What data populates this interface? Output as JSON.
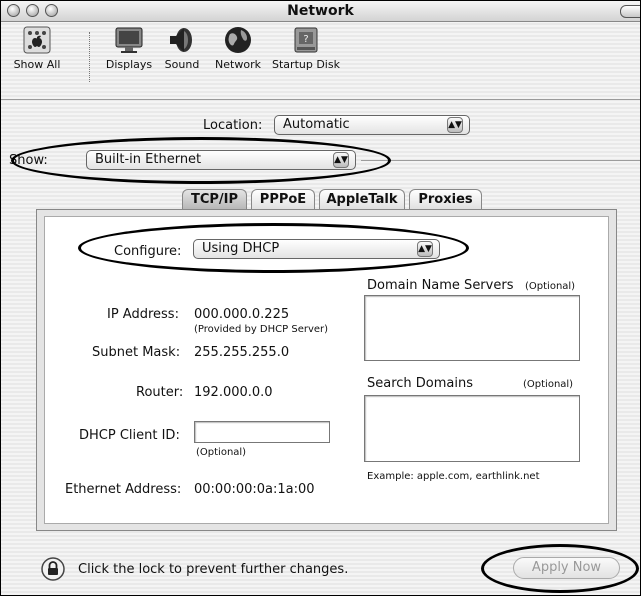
{
  "window": {
    "title": "Network"
  },
  "toolbar": {
    "items": [
      {
        "label": "Show All",
        "icon": "apple-grid-icon"
      },
      {
        "label": "Displays",
        "icon": "display-icon"
      },
      {
        "label": "Sound",
        "icon": "speaker-icon"
      },
      {
        "label": "Network",
        "icon": "globe-icon"
      },
      {
        "label": "Startup Disk",
        "icon": "disk-icon"
      }
    ]
  },
  "location": {
    "label": "Location:",
    "value": "Automatic"
  },
  "show": {
    "label": "Show:",
    "value": "Built-in Ethernet"
  },
  "tabs": [
    {
      "label": "TCP/IP",
      "selected": true
    },
    {
      "label": "PPPoE",
      "selected": false
    },
    {
      "label": "AppleTalk",
      "selected": false
    },
    {
      "label": "Proxies",
      "selected": false
    }
  ],
  "tcpip": {
    "configure": {
      "label": "Configure:",
      "value": "Using DHCP"
    },
    "ip_address": {
      "label": "IP Address:",
      "value": "000.000.0.225",
      "note": "(Provided by DHCP Server)"
    },
    "subnet_mask": {
      "label": "Subnet Mask:",
      "value": "255.255.255.0"
    },
    "router": {
      "label": "Router:",
      "value": "192.000.0.0"
    },
    "dhcp_client_id": {
      "label": "DHCP Client ID:",
      "value": "",
      "note": "(Optional)"
    },
    "ethernet_address": {
      "label": "Ethernet Address:",
      "value": "00:00:00:0a:1a:00"
    },
    "dns": {
      "label": "Domain Name Servers",
      "optional": "(Optional)",
      "value": ""
    },
    "search_domains": {
      "label": "Search Domains",
      "optional": "(Optional)",
      "value": "",
      "example": "Example: apple.com, earthlink.net"
    }
  },
  "footer": {
    "lock_text": "Click the lock to prevent further changes.",
    "apply_label": "Apply Now"
  }
}
